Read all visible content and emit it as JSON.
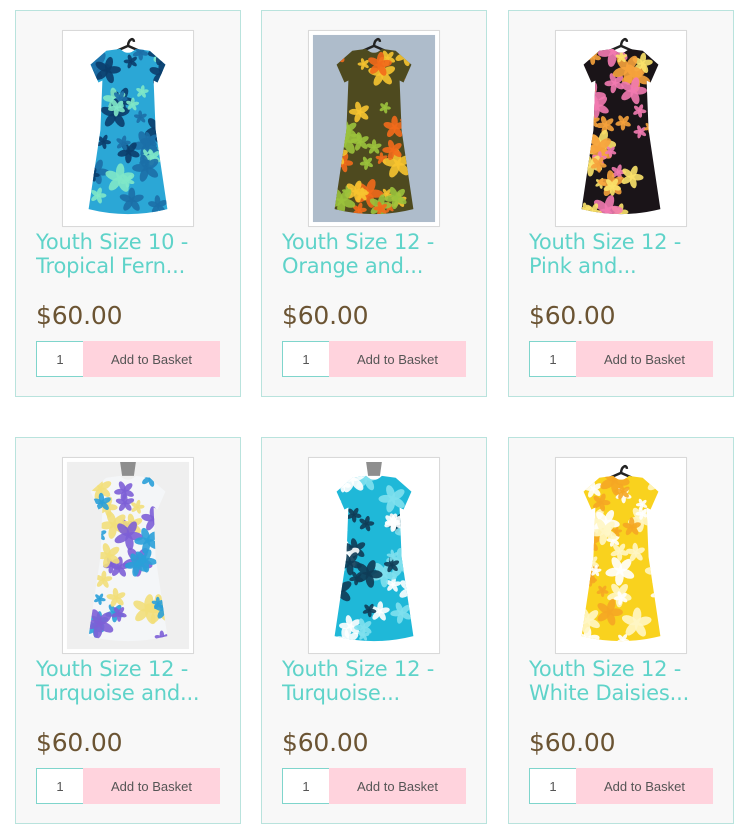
{
  "products": [
    {
      "title_line1": "Youth Size 10 -",
      "title_line2": "Tropical Fern...",
      "price": "$60.00",
      "quantity": "1",
      "add_label": "Add to Basket",
      "image": {
        "bg": "#ffffff",
        "dress": "#2ba7d6",
        "accent1": "#1c6fa7",
        "accent2": "#7fe8c8",
        "accent3": "#0b3d6b",
        "mannequin": false
      }
    },
    {
      "title_line1": "Youth Size 12 -",
      "title_line2": "Orange and...",
      "price": "$60.00",
      "quantity": "1",
      "add_label": "Add to Basket",
      "image": {
        "bg": "#aebccb",
        "dress": "#4e4a1f",
        "accent1": "#f26a1b",
        "accent2": "#f7c430",
        "accent3": "#9bc23c",
        "mannequin": false
      }
    },
    {
      "title_line1": "Youth Size 12 -",
      "title_line2": "Pink and...",
      "price": "$60.00",
      "quantity": "1",
      "add_label": "Add to Basket",
      "image": {
        "bg": "#ffffff",
        "dress": "#1a1418",
        "accent1": "#f27ab0",
        "accent2": "#f6a23c",
        "accent3": "#fbe26a",
        "mannequin": false
      }
    },
    {
      "title_line1": "Youth Size 12 -",
      "title_line2": "Turquoise and...",
      "price": "$60.00",
      "quantity": "1",
      "add_label": "Add to Basket",
      "image": {
        "bg": "#efefef",
        "dress": "#f4f6f8",
        "accent1": "#2aa0d8",
        "accent2": "#7d5fd6",
        "accent3": "#f2df7a",
        "mannequin": true
      }
    },
    {
      "title_line1": "Youth Size 12 -",
      "title_line2": "Turquoise...",
      "price": "$60.00",
      "quantity": "1",
      "add_label": "Add to Basket",
      "image": {
        "bg": "#ffffff",
        "dress": "#1fb8d8",
        "accent1": "#ffffff",
        "accent2": "#0f3c56",
        "accent3": "#7fe0ee",
        "mannequin": true
      }
    },
    {
      "title_line1": "Youth Size 12 -",
      "title_line2": "White Daisies...",
      "price": "$60.00",
      "quantity": "1",
      "add_label": "Add to Basket",
      "image": {
        "bg": "#ffffff",
        "dress": "#f9d21e",
        "accent1": "#ffffff",
        "accent2": "#f5a623",
        "accent3": "#fff6c4",
        "mannequin": false
      }
    }
  ]
}
